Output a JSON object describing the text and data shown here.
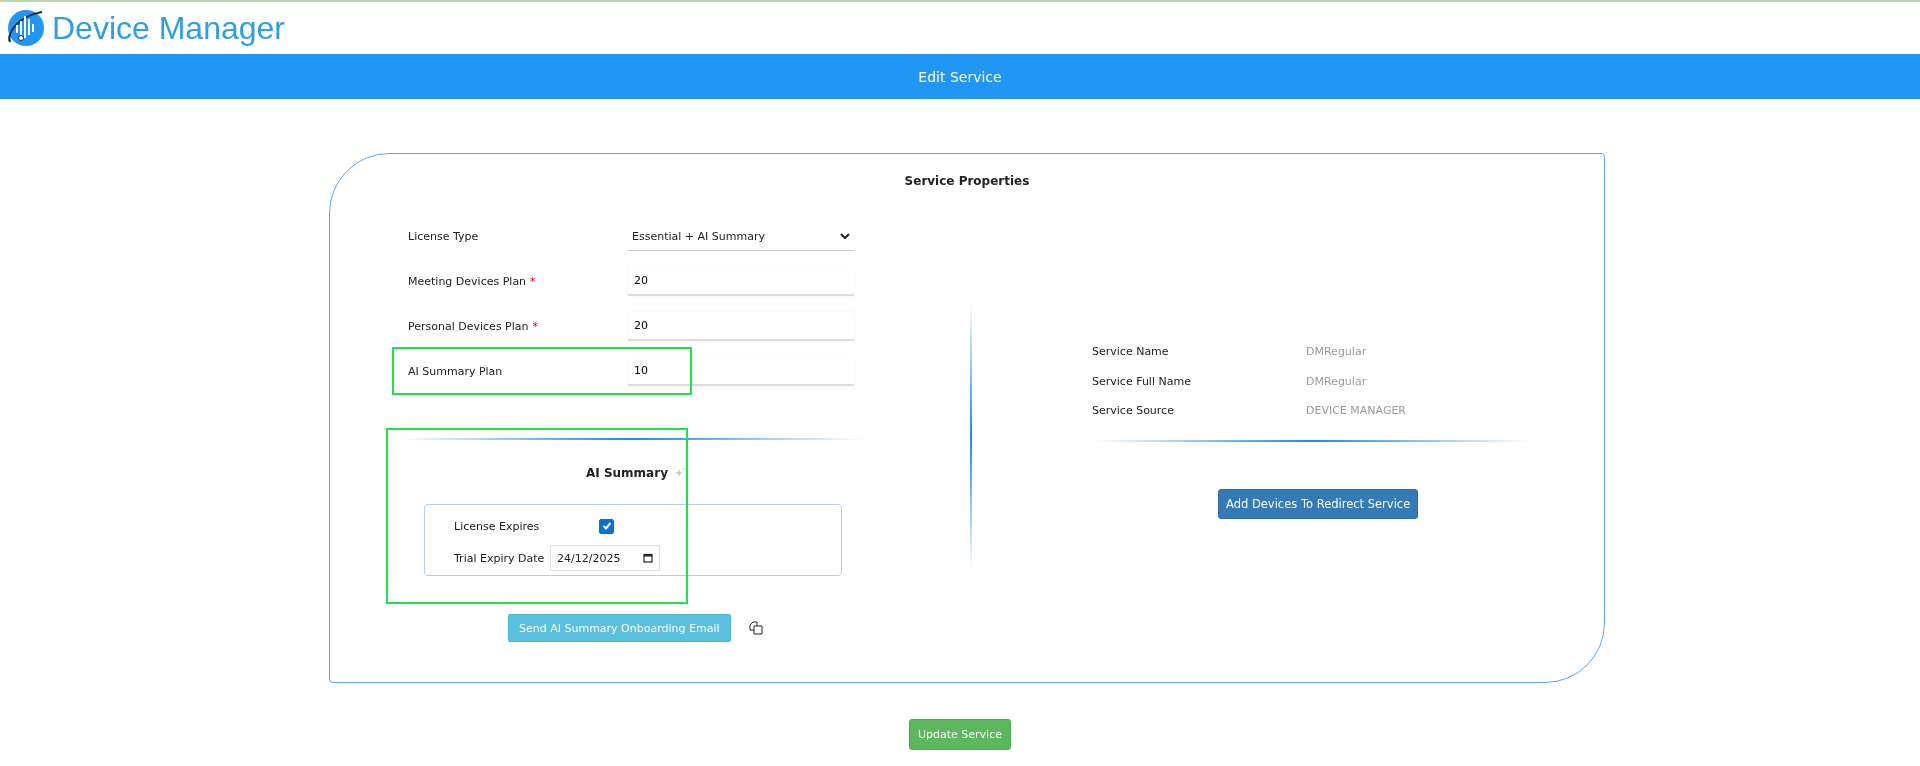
{
  "app": {
    "title": "Device Manager"
  },
  "header_bar": {
    "title": "Edit Service"
  },
  "card": {
    "title": "Service Properties"
  },
  "fields": [
    {
      "kind": "select",
      "label": "License Type",
      "value": "Essential + AI Summary",
      "highlighted": false
    },
    {
      "kind": "input",
      "label": "Meeting Devices Plan",
      "required_mark": "*",
      "value": "20",
      "highlighted": false
    },
    {
      "kind": "input",
      "label": "Personal Devices Plan",
      "required_mark": "*",
      "value": "20",
      "highlighted": false
    },
    {
      "kind": "input",
      "label": "AI Summary Plan",
      "value": "10",
      "highlighted": true
    }
  ],
  "ai_summary": {
    "title": "AI Summary",
    "highlighted": true,
    "license_expires": {
      "label": "License Expires",
      "checked": true
    },
    "trial_expiry": {
      "label": "Trial Expiry Date",
      "value": "24/12/2025"
    },
    "send_button": "Send AI Summary Onboarding Email"
  },
  "service_info": [
    {
      "label": "Service Name",
      "value": "DMRegular"
    },
    {
      "label": "Service Full Name",
      "value": "DMRegular"
    },
    {
      "label": "Service Source",
      "value": "DEVICE MANAGER"
    }
  ],
  "redirect_button": "Add Devices To Redirect Service",
  "update_button": "Update Service"
}
